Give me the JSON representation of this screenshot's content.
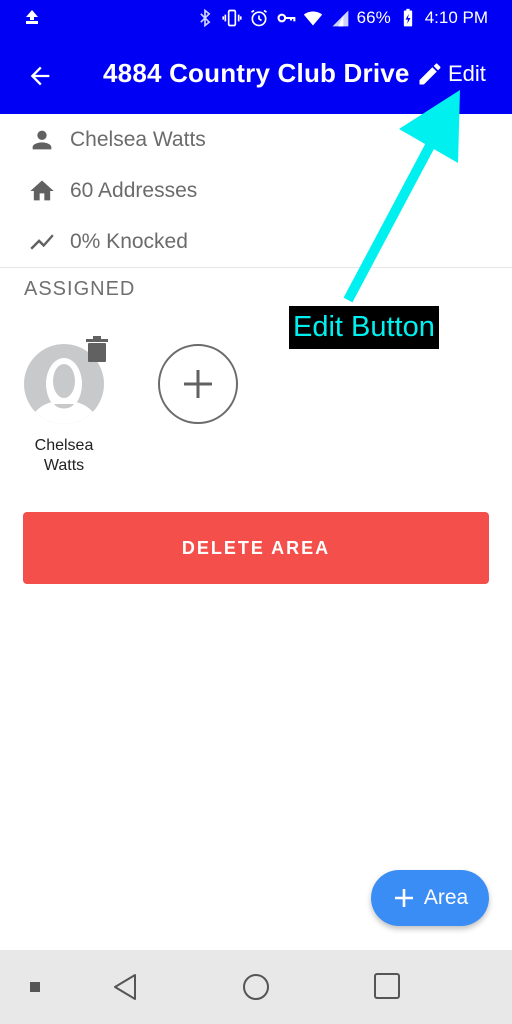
{
  "status_bar": {
    "battery": "66%",
    "time": "4:10 PM",
    "icons": [
      "upload-icon",
      "bluetooth-icon",
      "vibrate-icon",
      "alarm-icon",
      "vpn-key-icon",
      "wifi-icon",
      "signal-icon",
      "battery-charging-icon"
    ]
  },
  "header": {
    "title": "4884 Country Club Drive",
    "edit_label": "Edit"
  },
  "details": {
    "assignee": "Chelsea Watts",
    "addresses": "60 Addresses",
    "knocked": "0% Knocked"
  },
  "assigned": {
    "label": "ASSIGNED",
    "members": [
      {
        "name_line1": "Chelsea",
        "name_line2": "Watts"
      }
    ]
  },
  "actions": {
    "delete_area": "DELETE AREA",
    "add_area": "Area"
  },
  "annotation": {
    "label": "Edit Button"
  },
  "colors": {
    "app_bar": "#0000f5",
    "delete": "#f44f4a",
    "fab": "#3a8df5",
    "annotation": "#00f0f0"
  }
}
